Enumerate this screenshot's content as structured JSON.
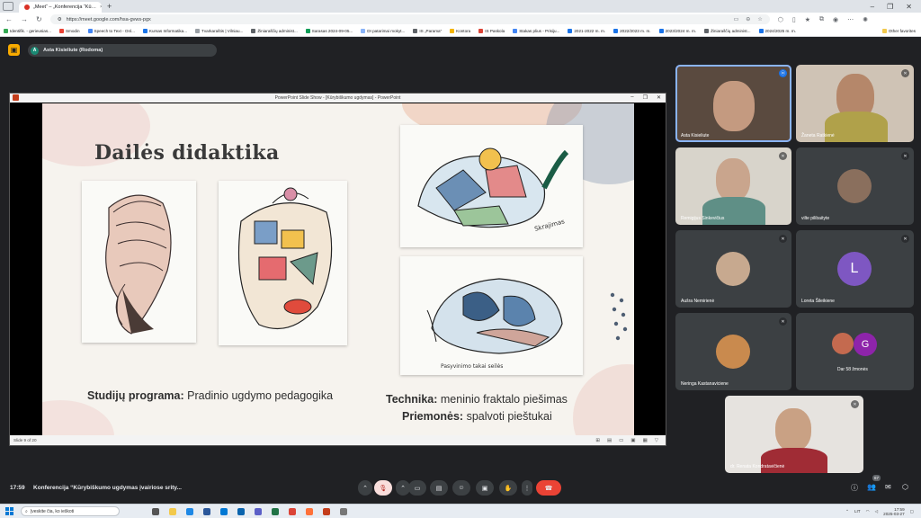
{
  "browser": {
    "tab_title": "„Meet“ – „Konferencija “Kū…",
    "url": "https://meet.google.com/hsa-gvws-pgx",
    "bookmarks": [
      "Identifik. - gerieusias...",
      "Smodin",
      "Speech to Text - Onl...",
      "Kursas Informatika...",
      "Tvarkaraštis | Vilniau...",
      "Žiniaraščių administ...",
      "Sarasas 2024-09-05...",
      "DI patarimai mokyt...",
      "IS „Parama“",
      "Kontora",
      "IS Paskola",
      "Stakas plius - Prisiju...",
      "2021-2022 m. m.",
      "2022/2023 m. m.",
      "2023/2024 m. m.",
      "Žiniaraščių administ...",
      "2024/2025 m. m."
    ],
    "other_favorites": "Other favorites"
  },
  "meet": {
    "presenter": "Asta Kisieliute (Rodoma)",
    "presenter_initial": "A",
    "clock": "17:59",
    "meeting_title": "Konferencija “Kūrybiškumo ugdymas įvairiose srity...",
    "participant_count": "67"
  },
  "powerpoint": {
    "window_title": "PowerPoint Slide Show - [Kūrybiškumo ugdymas] - PowerPoint",
    "status": "Slide 9 of 20"
  },
  "slide": {
    "title": "Dailės didaktika",
    "program_label": "Studijų programa:",
    "program_value": " Pradinio ugdymo pedagogika",
    "technique_label": "Technika:",
    "technique_value": " meninio fraktalo piešimas",
    "tools_label": "Priemonės:",
    "tools_value": " spalvoti pieštukai"
  },
  "participants": [
    {
      "name": "Asta Kisieliute"
    },
    {
      "name": "Žaneta Ratkienė"
    },
    {
      "name": "Remigijus Sinkevičius"
    },
    {
      "name": "vilte pilibaityte"
    },
    {
      "name": "Aušra Nemirienė"
    },
    {
      "name": "Loreta Šileikiene",
      "initial": "L"
    },
    {
      "name": "Neringa Kastanaviciene"
    },
    {
      "name": "Dar 58 žmonės",
      "initial": "G"
    },
    {
      "name": "dr. Renata Kondratavičienė"
    }
  ],
  "taskbar": {
    "search_placeholder": "Įveskite čia, ko ieškoti",
    "lang": "LIT",
    "time": "17:59",
    "date": "2025-03-27"
  },
  "colors": {
    "meet_bg": "#202124",
    "tile_bg": "#3c4043",
    "end_call": "#ea4335",
    "accent": "#8ab4f8"
  }
}
